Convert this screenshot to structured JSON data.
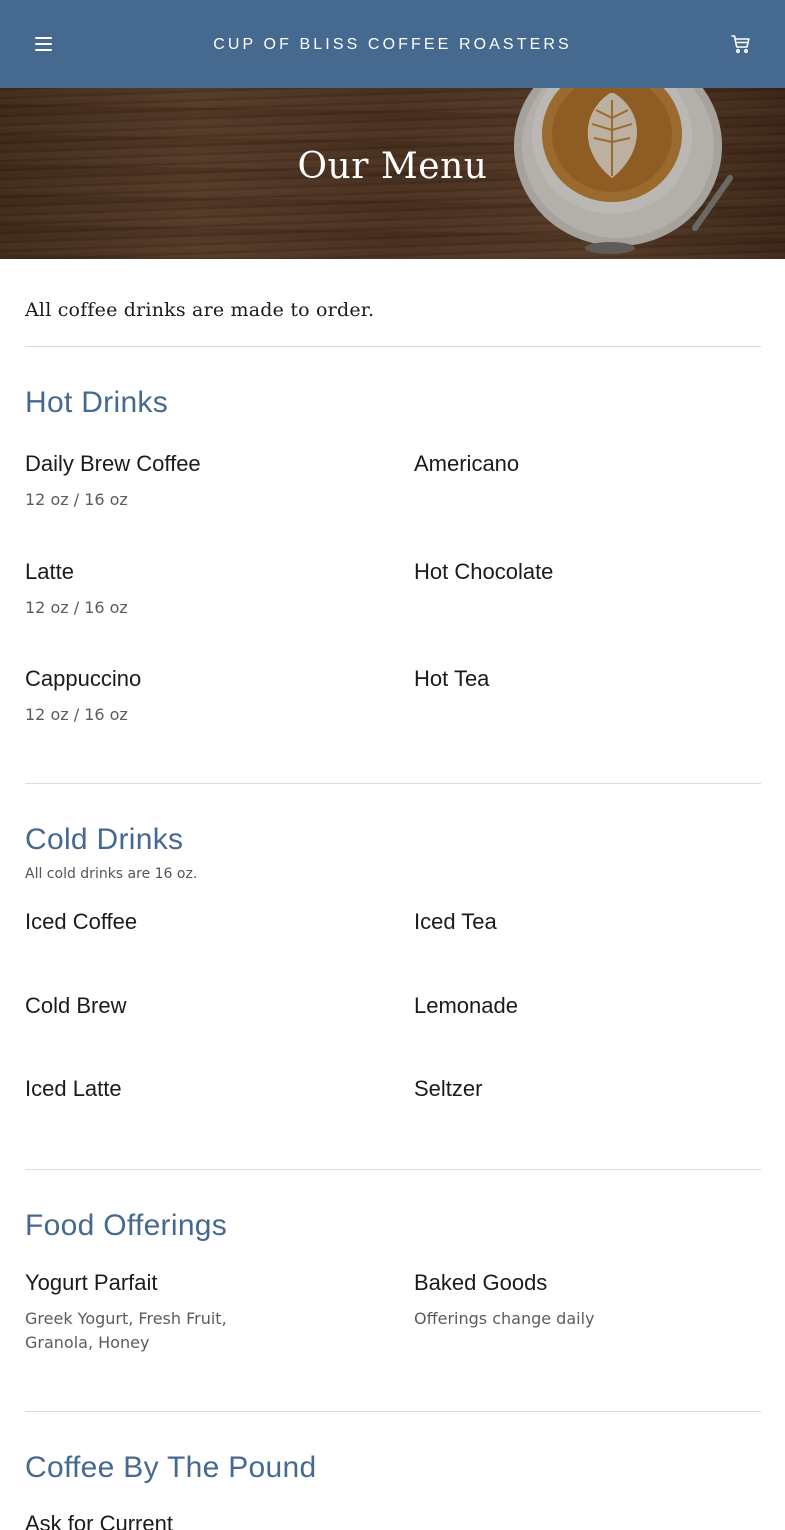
{
  "header": {
    "brand": "CUP OF BLISS COFFEE ROASTERS",
    "menu_icon": "hamburger-menu-icon",
    "cart_icon": "shopping-cart-icon",
    "background_color": "#46698f"
  },
  "hero": {
    "title": "Our Menu"
  },
  "intro": "All coffee drinks are made to order.",
  "sections": {
    "hot": {
      "title": "Hot Drinks",
      "items": [
        {
          "name": "Daily Brew Coffee",
          "desc": "12 oz / 16 oz"
        },
        {
          "name": "Americano",
          "desc": ""
        },
        {
          "name": "Latte",
          "desc": "12 oz / 16 oz"
        },
        {
          "name": "Hot Chocolate",
          "desc": ""
        },
        {
          "name": "Cappuccino",
          "desc": "12 oz / 16 oz"
        },
        {
          "name": "Hot Tea",
          "desc": ""
        }
      ]
    },
    "cold": {
      "title": "Cold Drinks",
      "note": "All cold drinks are 16 oz.",
      "items": [
        {
          "name": "Iced Coffee"
        },
        {
          "name": "Iced Tea"
        },
        {
          "name": "Cold Brew"
        },
        {
          "name": "Lemonade"
        },
        {
          "name": "Iced Latte"
        },
        {
          "name": "Seltzer"
        }
      ]
    },
    "food": {
      "title": "Food Offerings",
      "items": [
        {
          "name": "Yogurt Parfait",
          "desc_line1": "Greek Yogurt, Fresh Fruit,",
          "desc_line2": "Granola, Honey"
        },
        {
          "name": "Baked Goods",
          "desc_line1": "Offerings change daily"
        }
      ]
    },
    "pound": {
      "title": "Coffee By The Pound",
      "items": [
        {
          "name": "Ask for Current"
        }
      ]
    }
  },
  "accent_color": "#46698f"
}
